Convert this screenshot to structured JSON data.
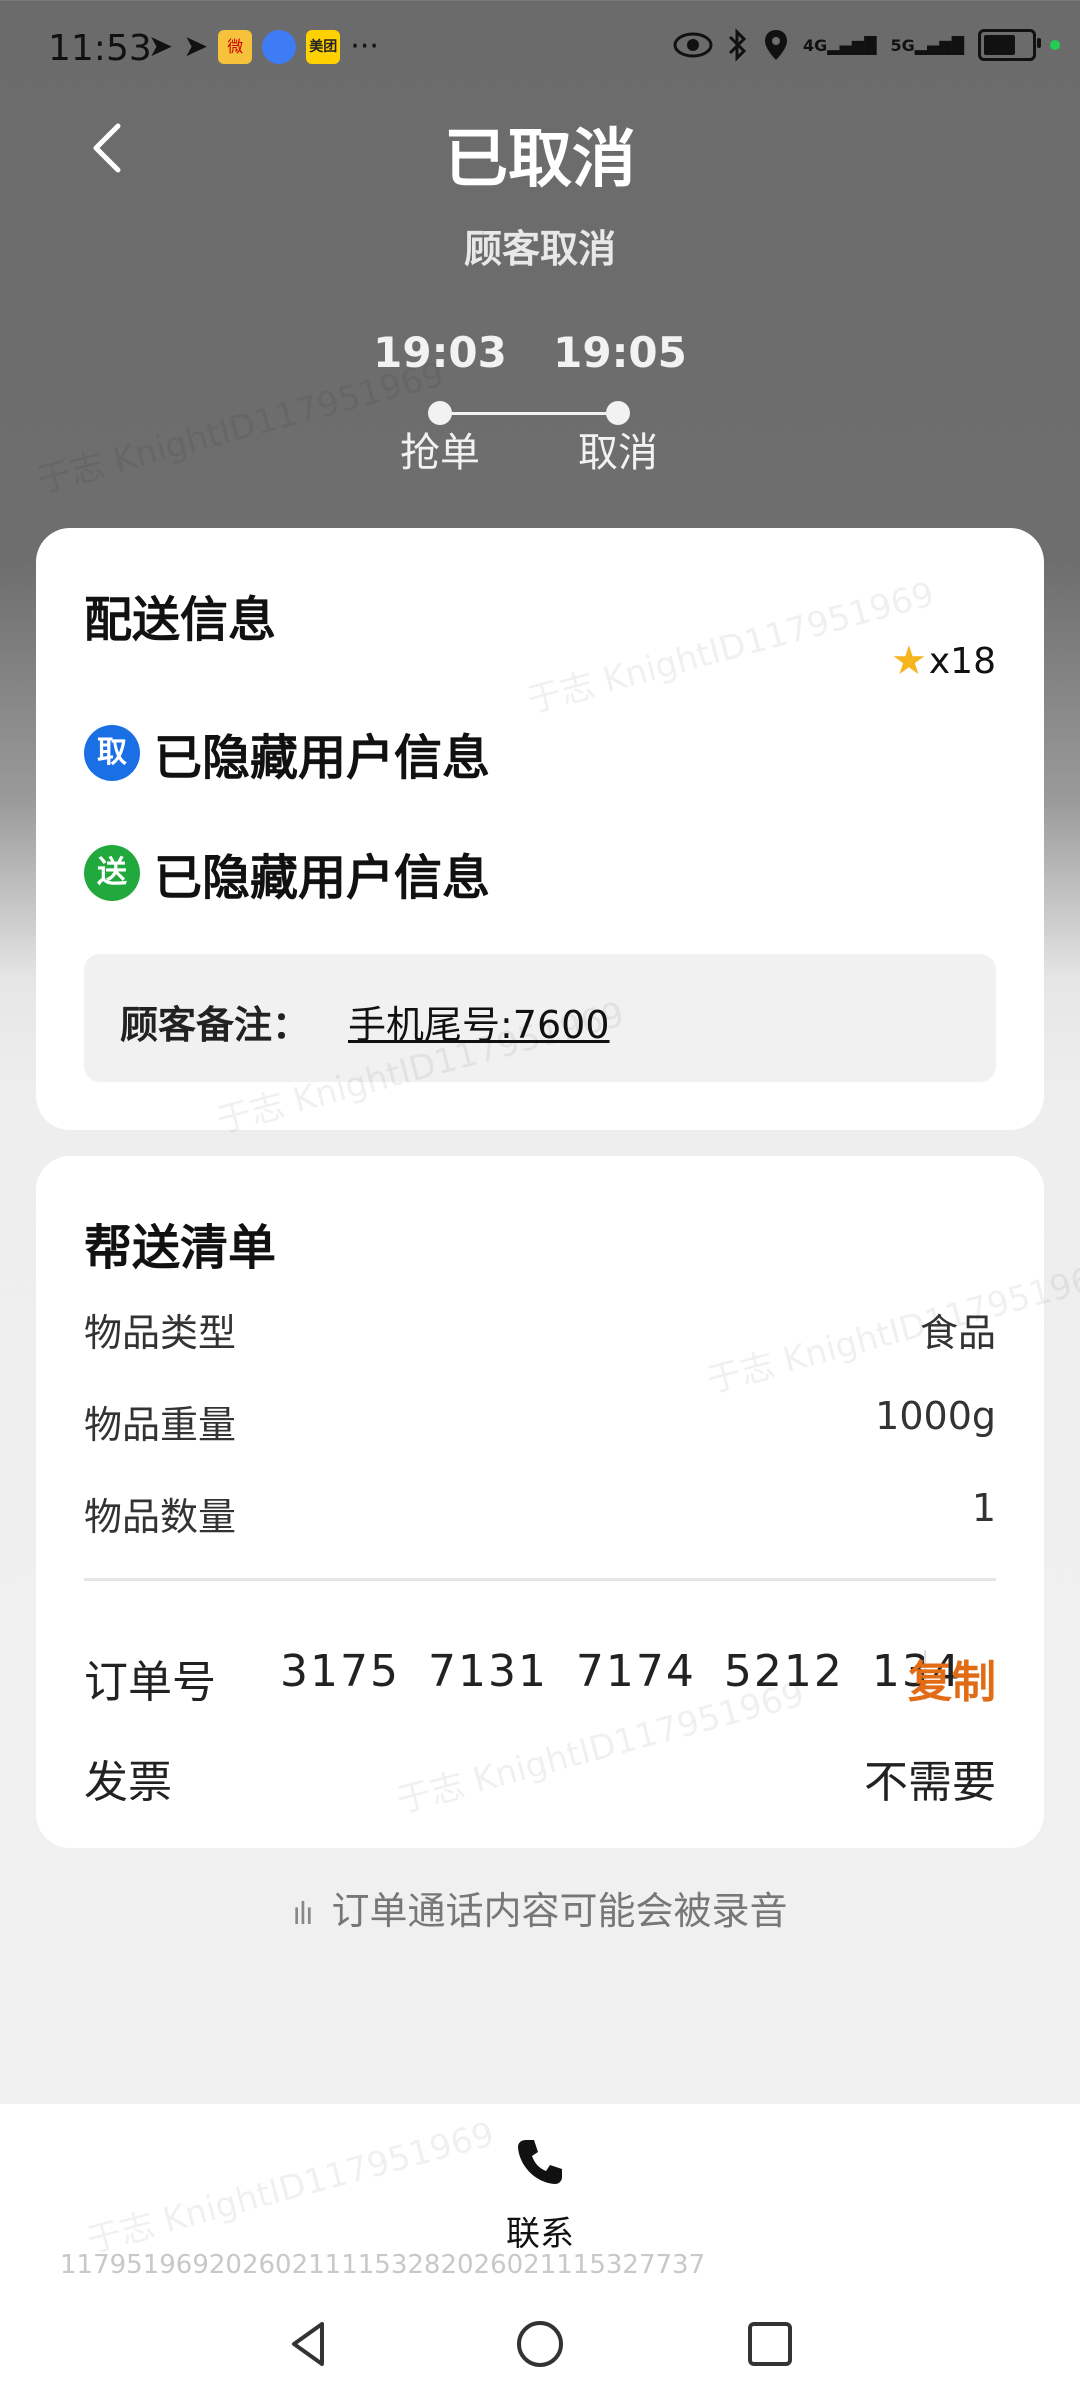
{
  "status_bar": {
    "time": "11:53",
    "ellipsis": "···",
    "app_badges": [
      "微",
      "",
      "美团"
    ],
    "network": [
      "4G",
      "5G"
    ]
  },
  "header": {
    "title": "已取消",
    "subtitle": "顾客取消",
    "timeline": [
      {
        "time": "19:03",
        "label": "抢单"
      },
      {
        "time": "19:05",
        "label": "取消"
      }
    ]
  },
  "delivery_card": {
    "title": "配送信息",
    "rating": "x18",
    "pickup_badge": "取",
    "pickup_text": "已隐藏用户信息",
    "dropoff_badge": "送",
    "dropoff_text": "已隐藏用户信息",
    "note_label": "顾客备注：",
    "note_value": "手机尾号:7600"
  },
  "items_card": {
    "title": "帮送清单",
    "rows": [
      {
        "key": "物品类型",
        "value": "食品"
      },
      {
        "key": "物品重量",
        "value": "1000g"
      },
      {
        "key": "物品数量",
        "value": "1"
      }
    ],
    "order_label": "订单号",
    "order_number": "3175 7131 7174 5212 134",
    "copy_label": "复制",
    "invoice_label": "发票",
    "invoice_value": "不需要"
  },
  "recording_notice": "订单通话内容可能会被录音",
  "bottom": {
    "contact_label": "联系",
    "watermark_id": "117951969202602111153282026021115327737"
  },
  "watermark_text": "于志 KnightID117951969",
  "colors": {
    "accent_orange": "#e26b16",
    "pickup_blue": "#1b6fe4",
    "dropoff_green": "#22a93e"
  }
}
